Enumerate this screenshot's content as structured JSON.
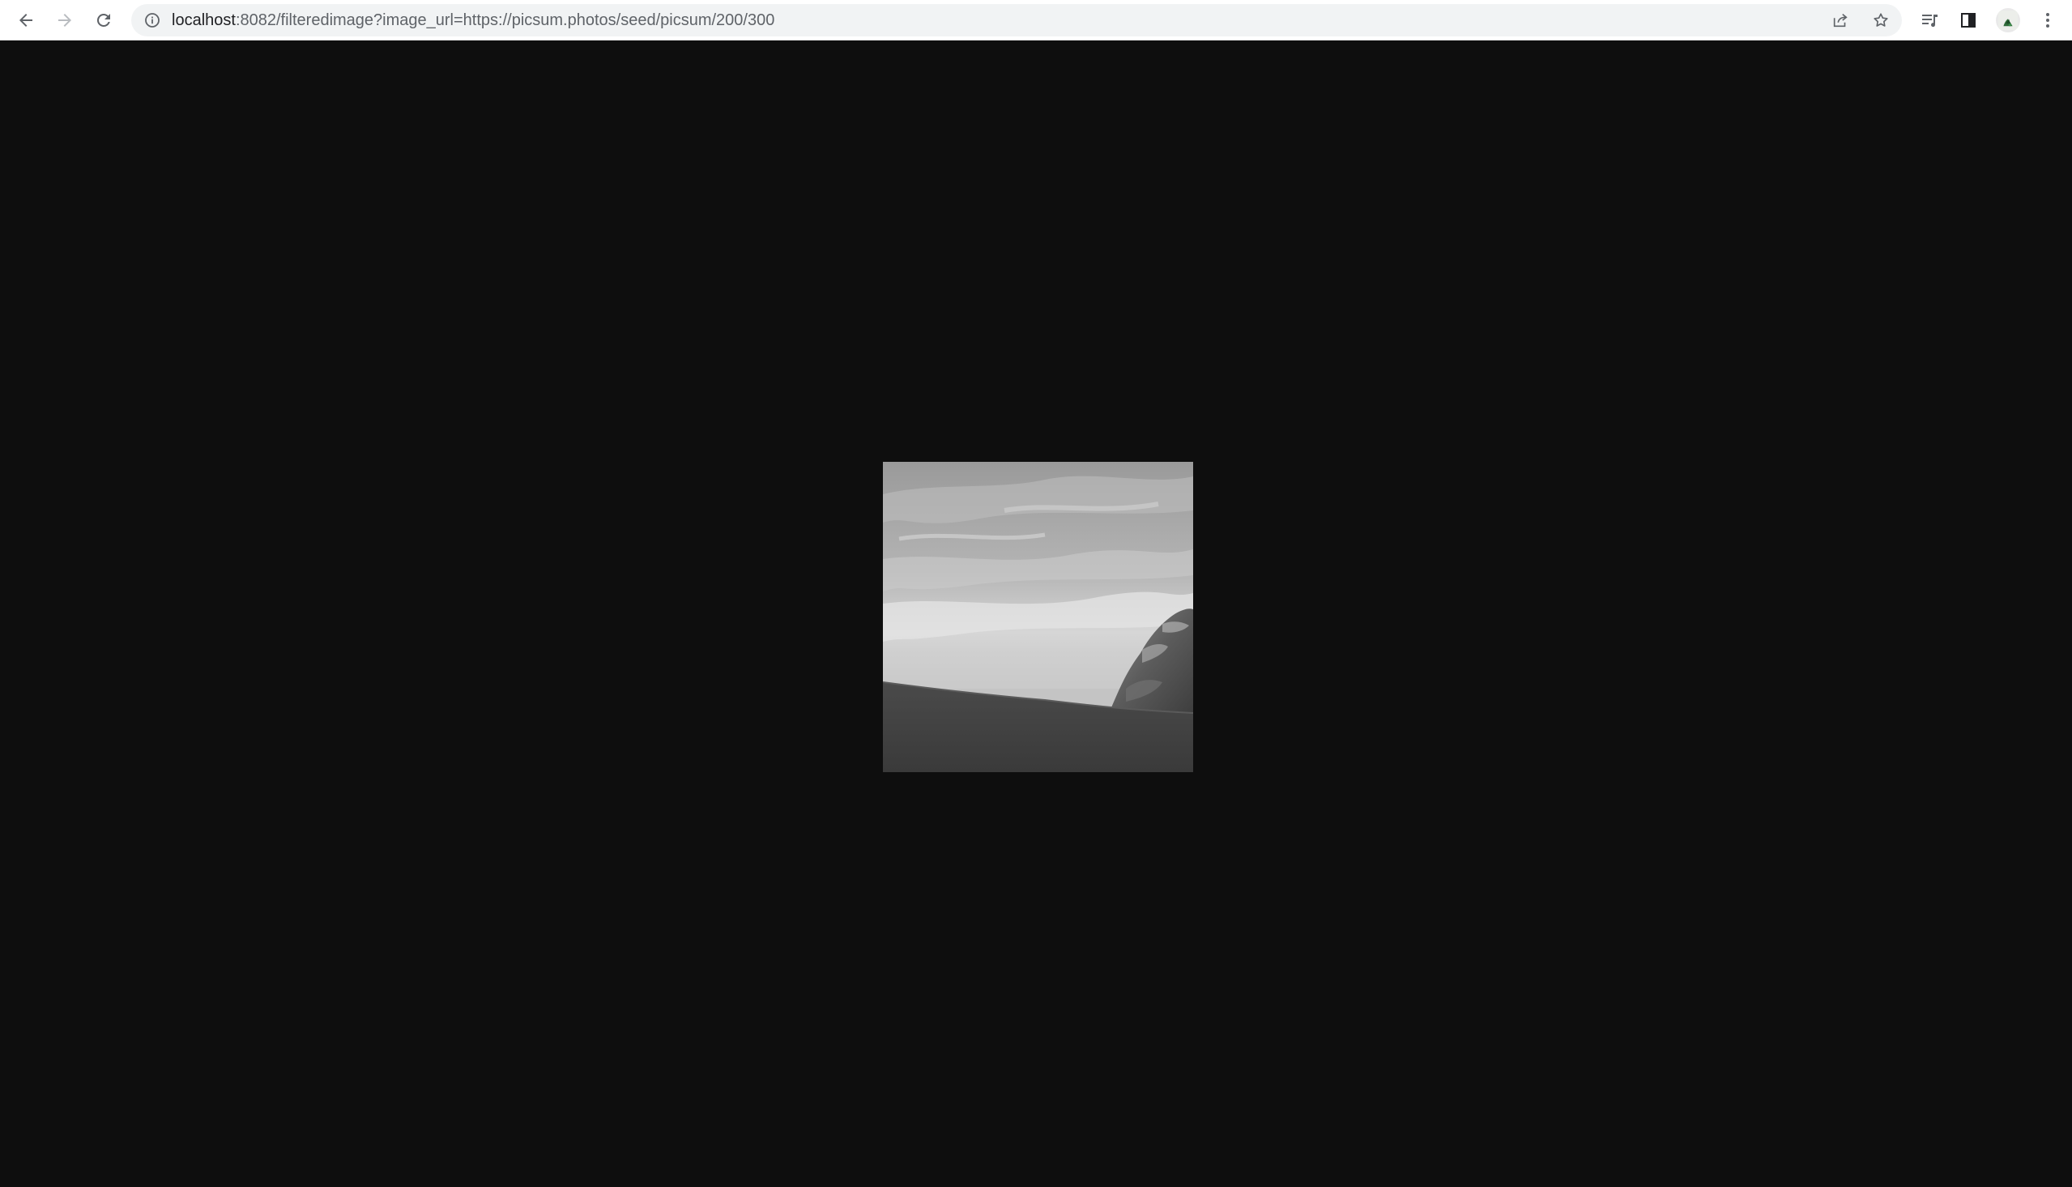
{
  "browser": {
    "url_host": "localhost",
    "url_rest": ":8082/filteredimage?image_url=https://picsum.photos/seed/picsum/200/300",
    "icons": {
      "back": "back-arrow-icon",
      "forward": "forward-arrow-icon",
      "reload": "reload-icon",
      "site_info": "info-icon",
      "share": "share-icon",
      "bookmark": "star-icon",
      "media": "media-queue-icon",
      "side_panel": "side-panel-icon",
      "profile": "avatar",
      "menu": "kebab-menu-icon"
    }
  },
  "page": {
    "background": "#0e0e0e",
    "image": {
      "description": "grayscale",
      "filter": "grayscale"
    }
  }
}
